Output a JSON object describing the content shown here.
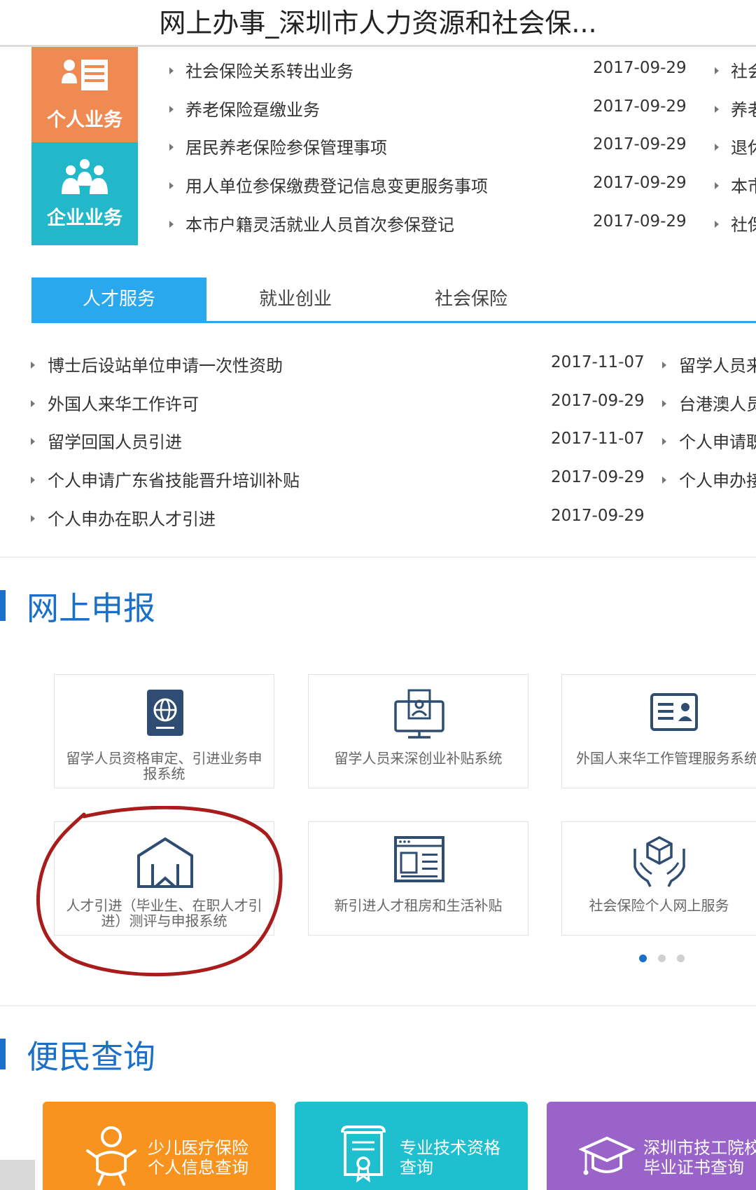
{
  "header": {
    "title": "网上办事_深圳市人力资源和社会保..."
  },
  "categories": {
    "personal": "个人业务",
    "enterprise": "企业业务"
  },
  "top_list": [
    {
      "label": "社会保险关系转出业务",
      "date": "2017-09-29",
      "right": "社会"
    },
    {
      "label": "养老保险趸缴业务",
      "date": "2017-09-29",
      "right": "养老"
    },
    {
      "label": "居民养老保险参保管理事项",
      "date": "2017-09-29",
      "right": "退休"
    },
    {
      "label": "用人单位参保缴费登记信息变更服务事项",
      "date": "2017-09-29",
      "right": "本市"
    },
    {
      "label": "本市户籍灵活就业人员首次参保登记",
      "date": "2017-09-29",
      "right": "社保"
    }
  ],
  "tabs": [
    {
      "label": "人才服务",
      "active": true
    },
    {
      "label": "就业创业",
      "active": false
    },
    {
      "label": "社会保险",
      "active": false
    }
  ],
  "tab_list": [
    {
      "label": "博士后设站单位申请一次性资助",
      "date": "2017-11-07",
      "right": "留学人员来"
    },
    {
      "label": "外国人来华工作许可",
      "date": "2017-09-29",
      "right": "台港澳人员"
    },
    {
      "label": "留学回国人员引进",
      "date": "2017-11-07",
      "right": "个人申请职"
    },
    {
      "label": "个人申请广东省技能晋升培训补贴",
      "date": "2017-09-29",
      "right": "个人申办接"
    },
    {
      "label": "个人申办在职人才引进",
      "date": "2017-09-29",
      "right": ""
    }
  ],
  "online_report": {
    "title": "网上申报",
    "cards": [
      {
        "label": "留学人员资格审定、引进业务申报系统",
        "icon": "passport-globe-icon"
      },
      {
        "label": "留学人员来深创业补贴系统",
        "icon": "monitor-person-icon"
      },
      {
        "label": "外国人来华工作管理服务系统",
        "icon": "id-card-icon"
      },
      {
        "label": "人才引进（毕业生、在职人才引进）测评与申报系统",
        "icon": "house-bookmark-icon"
      },
      {
        "label": "新引进人才租房和生活补贴",
        "icon": "browser-window-icon"
      },
      {
        "label": "社会保险个人网上服务",
        "icon": "hands-box-icon"
      }
    ],
    "pagination": {
      "total": 3,
      "current": 1
    }
  },
  "convenience": {
    "title": "便民查询",
    "tiles": [
      {
        "label": "少儿医疗保险 个人信息查询",
        "line1": "少儿医疗保险",
        "line2": "个人信息查询",
        "color": "#f7931e",
        "icon": "baby-icon"
      },
      {
        "label": "专业技术资格 查询",
        "line1": "专业技术资格",
        "line2": "查询",
        "color": "#1ec0cf",
        "icon": "certificate-icon"
      },
      {
        "label": "深圳市技工院校 毕业证书查询",
        "line1": "深圳市技工院校",
        "line2": "毕业证书查询",
        "color": "#9a63c9",
        "icon": "graduation-cap-icon"
      }
    ]
  },
  "colors": {
    "accent": "#2aa8ee",
    "section": "#1a70c8",
    "annotation": "#a81c1c"
  }
}
